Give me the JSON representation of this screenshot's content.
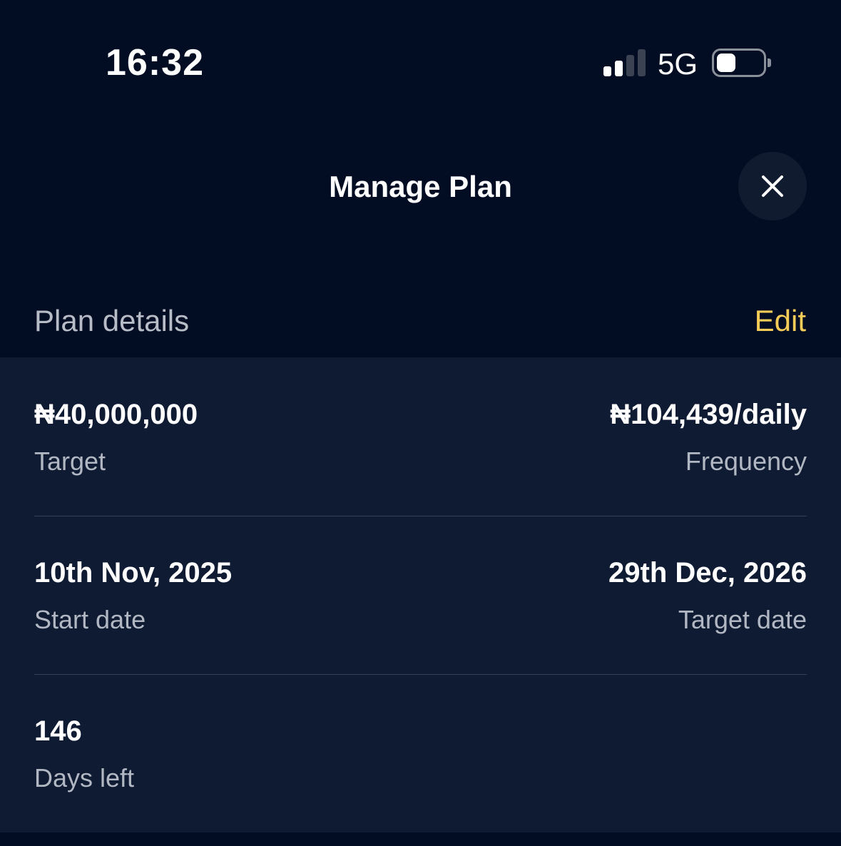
{
  "status_bar": {
    "time": "16:32",
    "network": "5G",
    "signal_icon": "cellular-signal-icon",
    "signal_bars_active": 2,
    "signal_bars_total": 4,
    "battery_icon": "battery-icon"
  },
  "header": {
    "title": "Manage Plan",
    "close_icon": "close-icon"
  },
  "section": {
    "title": "Plan details",
    "edit_label": "Edit"
  },
  "details": {
    "target": {
      "value": "₦40,000,000",
      "label": "Target"
    },
    "frequency": {
      "value": "₦104,439/daily",
      "label": "Frequency"
    },
    "start_date": {
      "value": "10th Nov, 2025",
      "label": "Start date"
    },
    "target_date": {
      "value": "29th Dec, 2026",
      "label": "Target date"
    },
    "days_left": {
      "value": "146",
      "label": "Days left"
    }
  },
  "colors": {
    "background": "#020d24",
    "card": "#0f1b32",
    "accent": "#f5cc58",
    "muted_text": "#b2b8c3",
    "close_button_bg": "#111b30"
  }
}
